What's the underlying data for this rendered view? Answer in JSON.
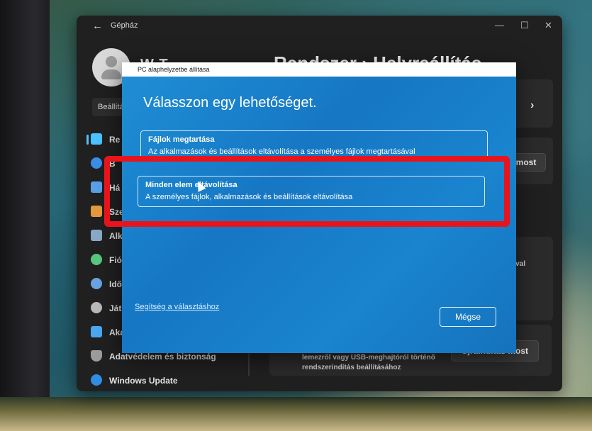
{
  "window": {
    "app_title": "Gépház",
    "back_glyph": "←",
    "minimize_glyph": "—",
    "maximize_glyph": "☐",
    "close_glyph": "✕"
  },
  "header": {
    "user_name_partial": "W     T",
    "heading": "Rendszer  ›  Helyreállítás",
    "search_partial": "Beállítás"
  },
  "nav": {
    "items": [
      {
        "label": "Re",
        "icon": "system-icon",
        "color": "#4cc2ff"
      },
      {
        "label": "B",
        "icon": "bluetooth-icon",
        "color": "#3b8ee8"
      },
      {
        "label": "Há",
        "icon": "network-icon",
        "color": "#5aa0e6"
      },
      {
        "label": "Sze",
        "icon": "personalization-icon",
        "color": "#e49a3c"
      },
      {
        "label": "Alk",
        "icon": "apps-icon",
        "color": "#8aa9c8"
      },
      {
        "label": "Fió",
        "icon": "accounts-icon",
        "color": "#58c77d"
      },
      {
        "label": "Idő",
        "icon": "time-language-icon",
        "color": "#6aa3e0"
      },
      {
        "label": "Ját",
        "icon": "gaming-icon",
        "color": "#b9b9b9"
      },
      {
        "label": "Akadálymentesség",
        "icon": "accessibility-icon",
        "color": "#4aa7f0"
      },
      {
        "label": "Adatvédelem és biztonság",
        "icon": "privacy-shield-icon",
        "color": "#9c9c9c"
      },
      {
        "label": "Windows Update",
        "icon": "windows-update-icon",
        "color": "#2f8de4"
      }
    ]
  },
  "right_panel": {
    "card1_partial": "ál",
    "reset_button_partial": "most",
    "card3_partial": "sával",
    "restart_description": "Az eszköz újraindítása a rendszerindítási beállítások módosításához, például lemezről vagy USB-meghajtóról történő rendszerindítás beállításához",
    "restart_button": "Újraindítás most"
  },
  "dialog": {
    "title": "PC alaphelyzetbe állítása",
    "heading": "Válasszon egy lehetőséget.",
    "options": [
      {
        "title": "Fájlok megtartása",
        "description": "Az alkalmazások és beállítások eltávolítása a személyes fájlok megtartásával"
      },
      {
        "title": "Minden elem eltávolítása",
        "description": "A személyes fájlok, alkalmazások és beállítások eltávolítása"
      }
    ],
    "help_link": "Segítség a választáshoz",
    "cancel_button": "Mégse"
  },
  "annotation": {
    "highlight_color": "#e8141c",
    "highlighted_option": "Minden elem eltávolítása"
  }
}
